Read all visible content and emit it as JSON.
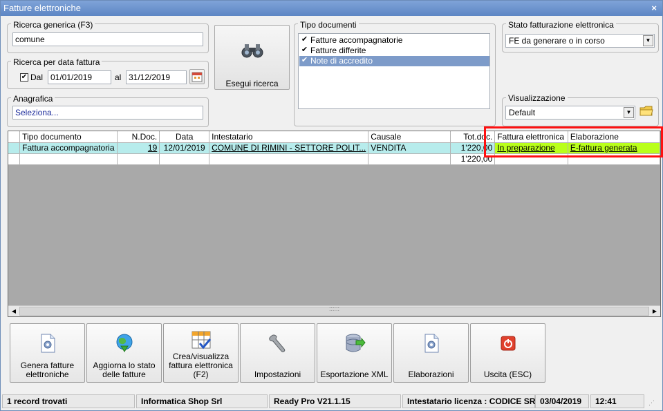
{
  "window": {
    "title": "Fatture elettroniche",
    "close": "×"
  },
  "search": {
    "generic_label": "Ricerca generica (F3)",
    "generic_value": "comune",
    "date_group_label": "Ricerca per data fattura",
    "date_from_label": "Dal",
    "date_from": "01/01/2019",
    "date_to_label": "al",
    "date_to": "31/12/2019",
    "anagrafica_label": "Anagrafica",
    "anagrafica_value": "Seleziona..."
  },
  "search_button": "Esegui ricerca",
  "tipo_documenti": {
    "label": "Tipo documenti",
    "items": [
      {
        "label": "Fatture accompagnatorie",
        "checked": true
      },
      {
        "label": "Fatture differite",
        "checked": true
      },
      {
        "label": "Note di accredito",
        "checked": true
      }
    ]
  },
  "stato": {
    "label": "Stato fatturazione elettronica",
    "value": "FE da generare o in corso"
  },
  "visualizzazione": {
    "label": "Visualizzazione",
    "value": "Default"
  },
  "grid": {
    "columns": [
      "Tipo documento",
      "N.Doc.",
      "Data",
      "Intestatario",
      "Causale",
      "Tot.doc.",
      "Fattura elettronica",
      "Elaborazione"
    ],
    "rows": [
      [
        "Fattura accompagnatoria",
        "19",
        "12/01/2019",
        "COMUNE DI RIMINI - SETTORE POLIT...",
        "VENDITA",
        "1'220,00",
        "In preparazione",
        "E-fattura generata"
      ]
    ],
    "total_row": [
      "",
      "",
      "",
      "",
      "",
      "1'220,00",
      "",
      ""
    ],
    "scroll_grip": "::::::"
  },
  "actions": [
    {
      "label": "Genera fatture elettroniche",
      "icon": "gear-document-icon"
    },
    {
      "label": "Aggiorna lo stato delle fatture",
      "icon": "globe-download-icon"
    },
    {
      "label": "Crea/visualizza fattura elettronica (F2)",
      "icon": "grid-check-icon"
    },
    {
      "label": "Impostazioni",
      "icon": "wrench-icon"
    },
    {
      "label": "Esportazione XML",
      "icon": "database-export-icon"
    },
    {
      "label": "Elaborazioni",
      "icon": "gear-document-icon"
    },
    {
      "label": "Uscita (ESC)",
      "icon": "power-icon"
    }
  ],
  "status": {
    "records": "1 record trovati",
    "company": "Informatica Shop Srl",
    "version": "Ready Pro V21.1.15",
    "license": "Intestatario licenza : CODICE SRL",
    "date": "03/04/2019",
    "time": "12:41"
  },
  "colors": {
    "accent_green": "#b9ff1b",
    "selection": "#b7ecec",
    "highlight_red": "#ff1010"
  }
}
